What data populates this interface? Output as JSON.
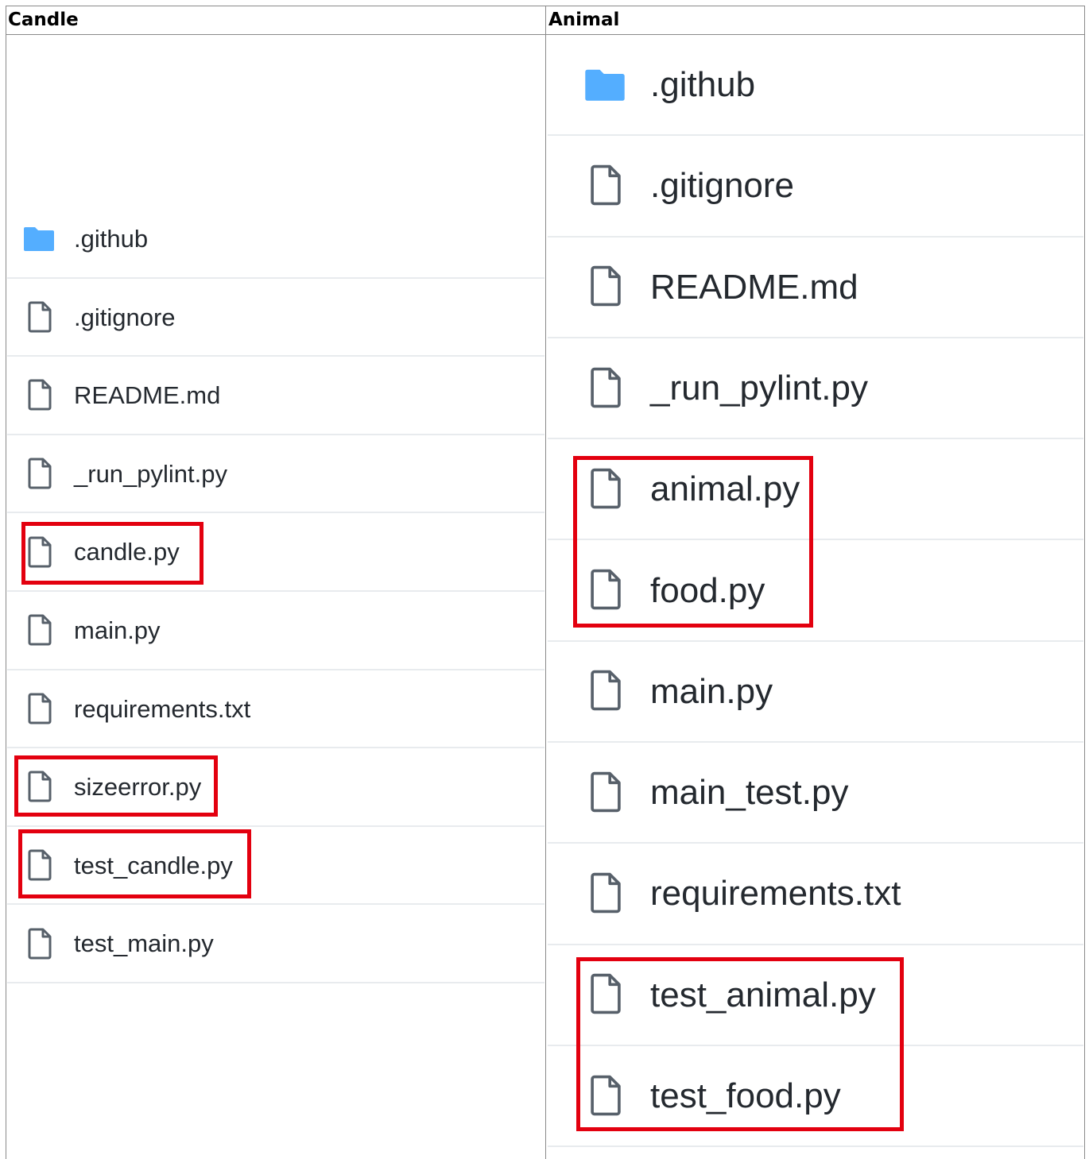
{
  "columns": [
    {
      "header": "Candle",
      "items": [
        {
          "name": ".github",
          "type": "folder-icon",
          "highlighted": false
        },
        {
          "name": ".gitignore",
          "type": "file-icon",
          "highlighted": false
        },
        {
          "name": "README.md",
          "type": "file-icon",
          "highlighted": false
        },
        {
          "name": "_run_pylint.py",
          "type": "file-icon",
          "highlighted": false
        },
        {
          "name": "candle.py",
          "type": "file-icon",
          "highlighted": true
        },
        {
          "name": "main.py",
          "type": "file-icon",
          "highlighted": false
        },
        {
          "name": "requirements.txt",
          "type": "file-icon",
          "highlighted": false
        },
        {
          "name": "sizeerror.py",
          "type": "file-icon",
          "highlighted": true
        },
        {
          "name": "test_candle.py",
          "type": "file-icon",
          "highlighted": true
        },
        {
          "name": "test_main.py",
          "type": "file-icon",
          "highlighted": false
        }
      ]
    },
    {
      "header": "Animal",
      "items": [
        {
          "name": ".github",
          "type": "folder-icon",
          "highlighted": false
        },
        {
          "name": ".gitignore",
          "type": "file-icon",
          "highlighted": false
        },
        {
          "name": "README.md",
          "type": "file-icon",
          "highlighted": false
        },
        {
          "name": "_run_pylint.py",
          "type": "file-icon",
          "highlighted": false
        },
        {
          "name": "animal.py",
          "type": "file-icon",
          "highlighted": true
        },
        {
          "name": "food.py",
          "type": "file-icon",
          "highlighted": true
        },
        {
          "name": "main.py",
          "type": "file-icon",
          "highlighted": false
        },
        {
          "name": "main_test.py",
          "type": "file-icon",
          "highlighted": false
        },
        {
          "name": "requirements.txt",
          "type": "file-icon",
          "highlighted": false
        },
        {
          "name": "test_animal.py",
          "type": "file-icon",
          "highlighted": true
        },
        {
          "name": "test_food.py",
          "type": "file-icon",
          "highlighted": true
        }
      ]
    }
  ],
  "colors": {
    "folder": "#54aeff",
    "file_icon": "#57606a",
    "text": "#24292f",
    "row_separator": "#e8ebee",
    "highlight": "#e3000f",
    "table_border": "#8a8a8a"
  }
}
